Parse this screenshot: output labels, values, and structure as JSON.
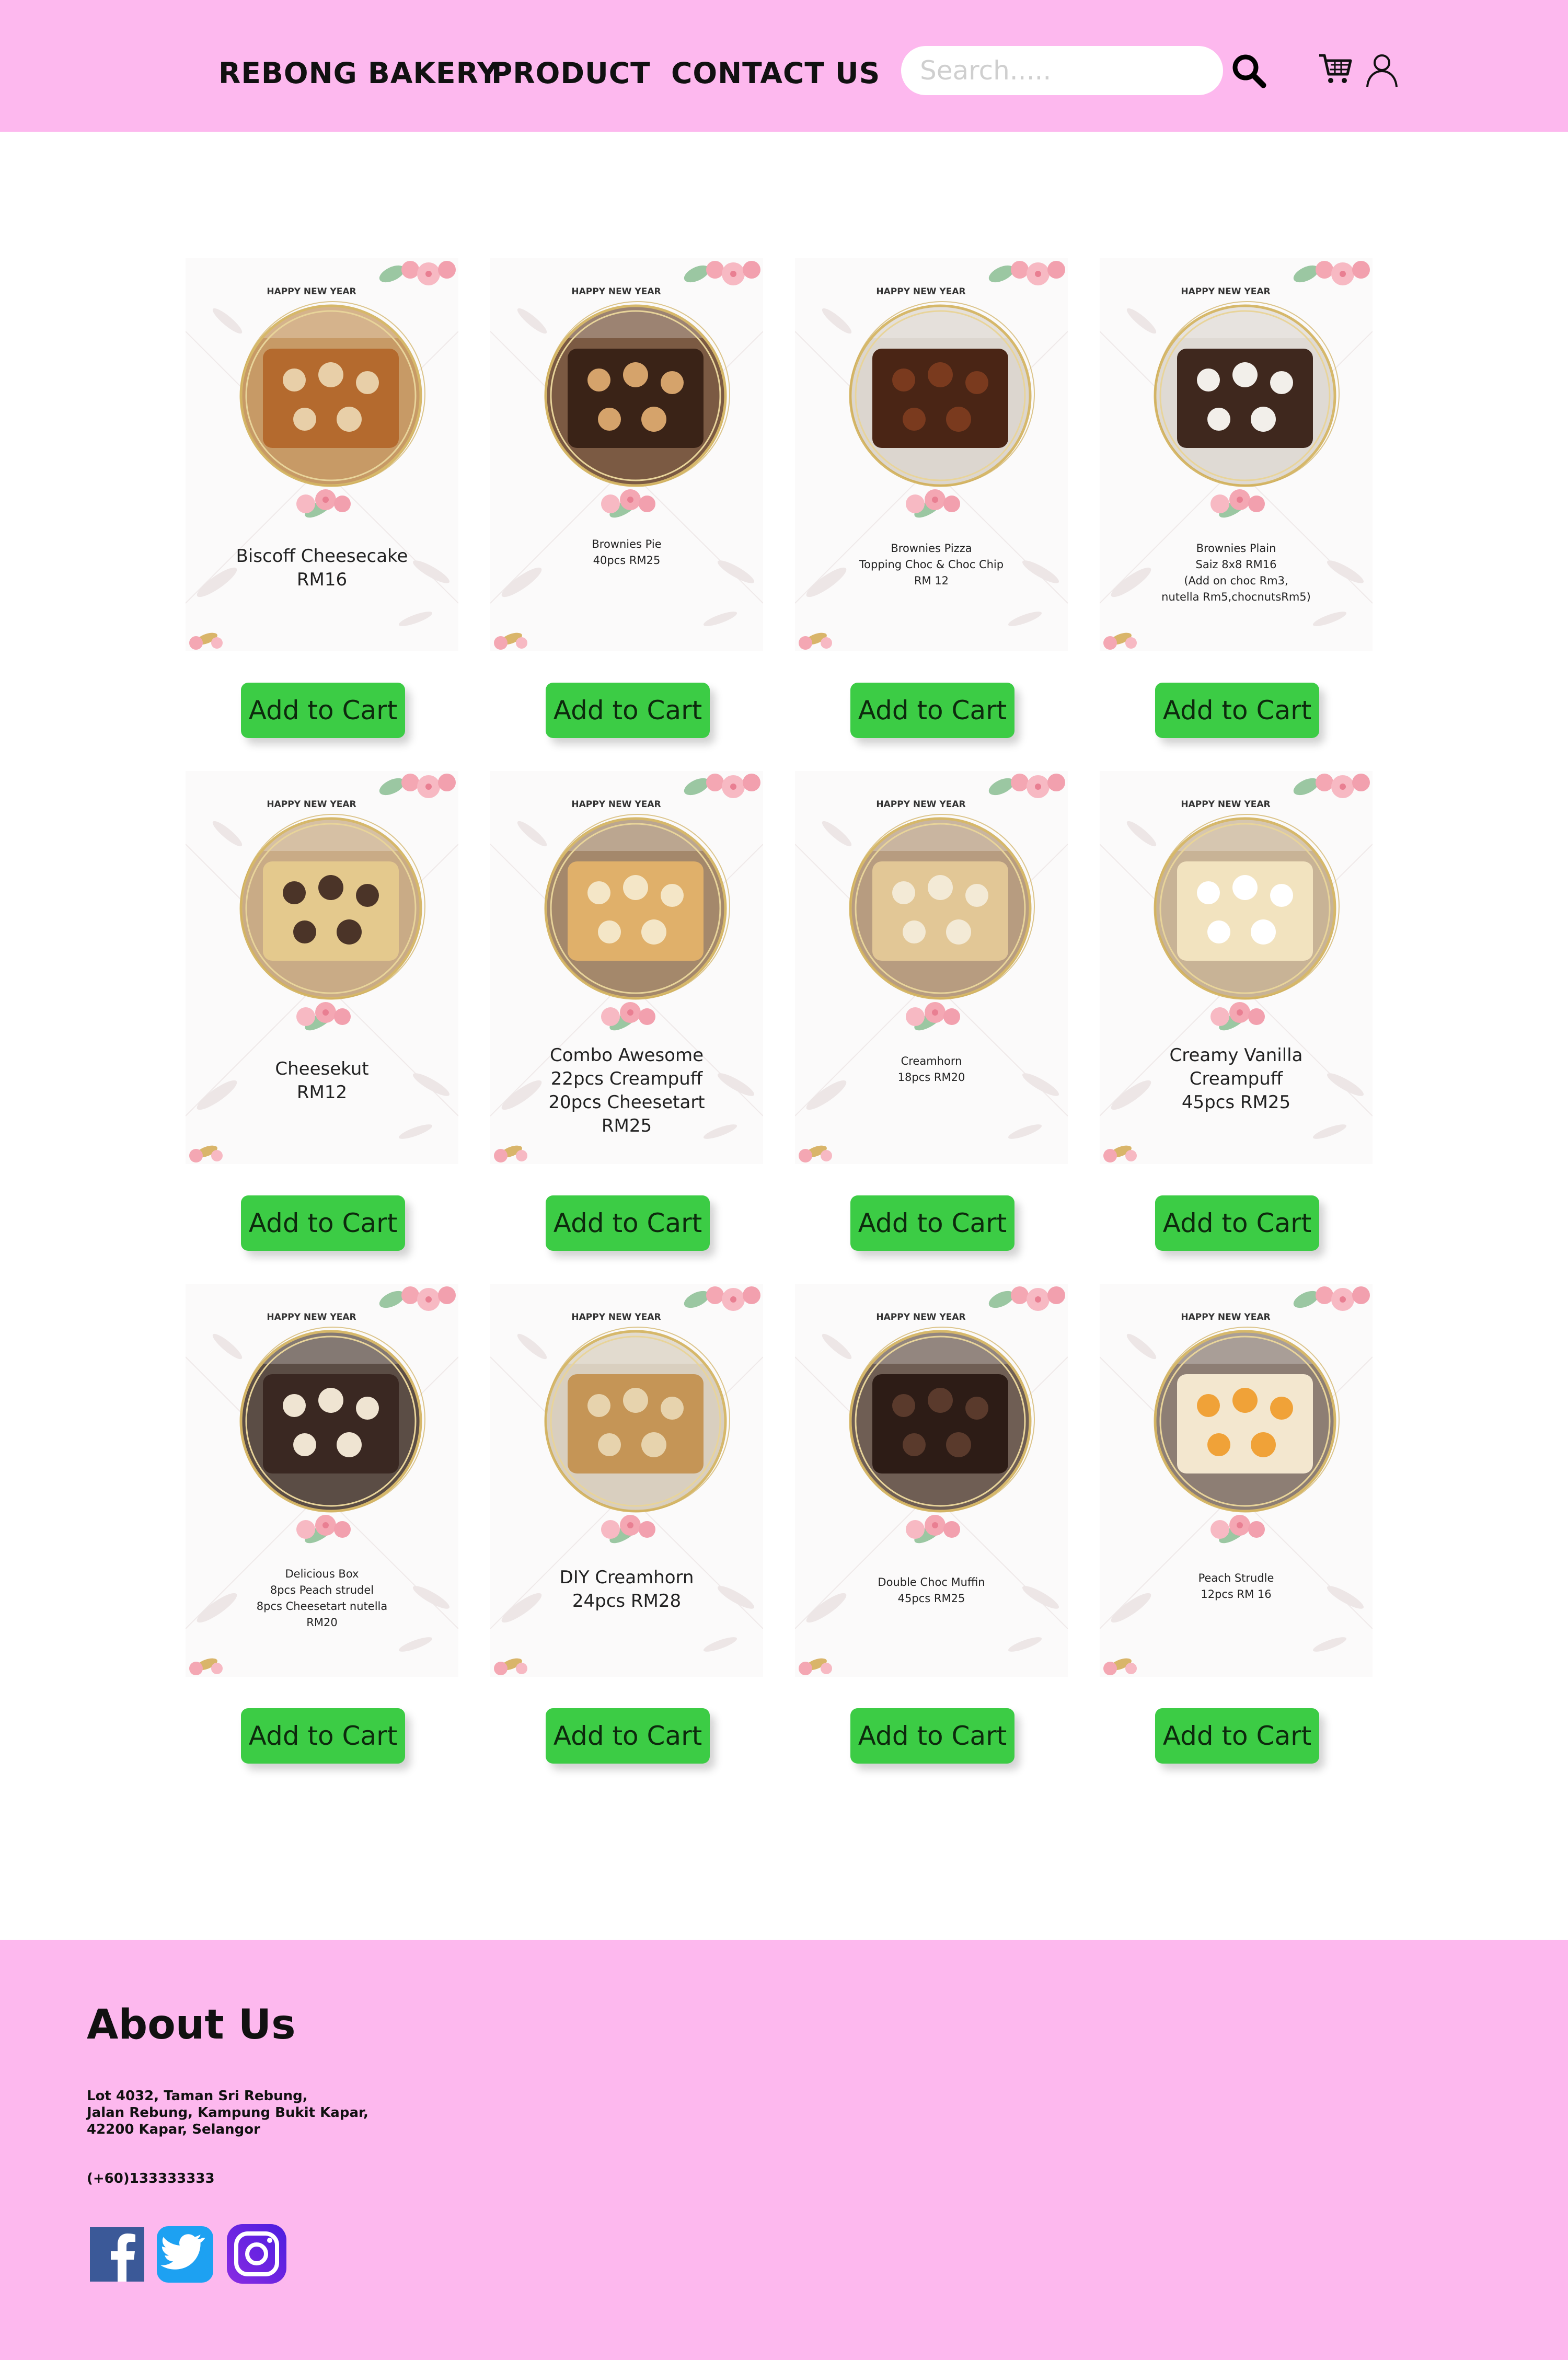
{
  "header": {
    "nav": [
      "REBONG BAKERY",
      "PRODUCT",
      "CONTACT US"
    ],
    "search_placeholder": "Search....."
  },
  "products": [
    {
      "badge": "HAPPY NEW YEAR",
      "caption": "Biscoff Cheesecake\nRM16",
      "size": "lg",
      "theme": "biscoff",
      "button": "Add to Cart"
    },
    {
      "badge": "HAPPY NEW YEAR",
      "caption": "Brownies Pie\n40pcs RM25",
      "size": "sm",
      "theme": "pie",
      "button": "Add to Cart"
    },
    {
      "badge": "HAPPY NEW YEAR",
      "caption": "Brownies Pizza\nTopping Choc & Choc Chip\nRM 12",
      "size": "sm",
      "theme": "pizza",
      "button": "Add to Cart"
    },
    {
      "badge": "HAPPY NEW YEAR",
      "caption": "Brownies Plain\nSaiz 8x8 RM16\n(Add on choc Rm3,\nnutella Rm5,chocnutsRm5)",
      "size": "sm",
      "theme": "plain",
      "button": "Add to Cart"
    },
    {
      "badge": "HAPPY NEW YEAR",
      "caption": "Cheesekut\nRM12",
      "size": "lg",
      "theme": "cheesekut",
      "button": "Add to Cart"
    },
    {
      "badge": "HAPPY NEW YEAR",
      "caption": "Combo Awesome\n22pcs Creampuff\n20pcs Cheesetart\nRM25",
      "size": "lg",
      "theme": "combo",
      "button": "Add to Cart"
    },
    {
      "badge": "HAPPY NEW YEAR",
      "caption": "Creamhorn\n18pcs RM20",
      "size": "sm",
      "theme": "creamhorn",
      "button": "Add to Cart"
    },
    {
      "badge": "HAPPY NEW YEAR",
      "caption": "Creamy Vanilla\nCreampuff\n45pcs RM25",
      "size": "lg",
      "theme": "creampuff",
      "button": "Add to Cart"
    },
    {
      "badge": "HAPPY NEW YEAR",
      "caption": "Delicious Box\n8pcs Peach strudel\n8pcs Cheesetart  nutella\nRM20",
      "size": "sm",
      "theme": "box",
      "button": "Add to Cart"
    },
    {
      "badge": "HAPPY NEW YEAR",
      "caption": "DIY Creamhorn\n24pcs RM28",
      "size": "lg",
      "theme": "diy",
      "button": "Add to Cart"
    },
    {
      "badge": "HAPPY NEW YEAR",
      "caption": "Double Choc Muffin\n45pcs RM25",
      "size": "sm",
      "theme": "muffin",
      "button": "Add to Cart"
    },
    {
      "badge": "HAPPY NEW YEAR",
      "caption": "Peach Strudle\n12pcs RM 16",
      "size": "sm",
      "theme": "peach",
      "button": "Add to Cart"
    }
  ],
  "footer": {
    "title": "About Us",
    "address": "Lot 4032, Taman Sri Rebung,\nJalan Rebung, Kampung Bukit Kapar,\n42200 Kapar, Selangor",
    "phone": "(+60)133333333",
    "social": [
      "facebook-icon",
      "twitter-icon",
      "instagram-icon"
    ]
  },
  "colors": {
    "header_bg": "#fdb8ee",
    "button_bg": "#3ccc45",
    "footer_bg": "#fdb8ee"
  }
}
